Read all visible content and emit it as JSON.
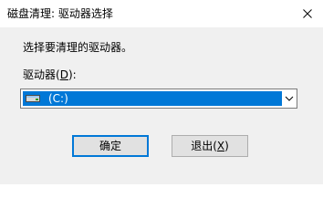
{
  "window": {
    "title": "磁盘清理: 驱动器选择"
  },
  "dialog": {
    "prompt": "选择要清理的驱动器。",
    "drive_label_prefix": "驱动器(",
    "drive_label_mnemonic": "D",
    "drive_label_suffix": "):",
    "selected_drive": "(C:)"
  },
  "buttons": {
    "ok_label": "确定",
    "exit_label_prefix": "退出(",
    "exit_label_mnemonic": "X",
    "exit_label_suffix": ")"
  },
  "icons": {
    "close": "close-icon",
    "drive": "drive-icon",
    "dropdown": "chevron-down-icon"
  },
  "colors": {
    "accent": "#0078d7",
    "dialog_bg": "#f0f0f0",
    "button_bg": "#e1e1e1"
  }
}
